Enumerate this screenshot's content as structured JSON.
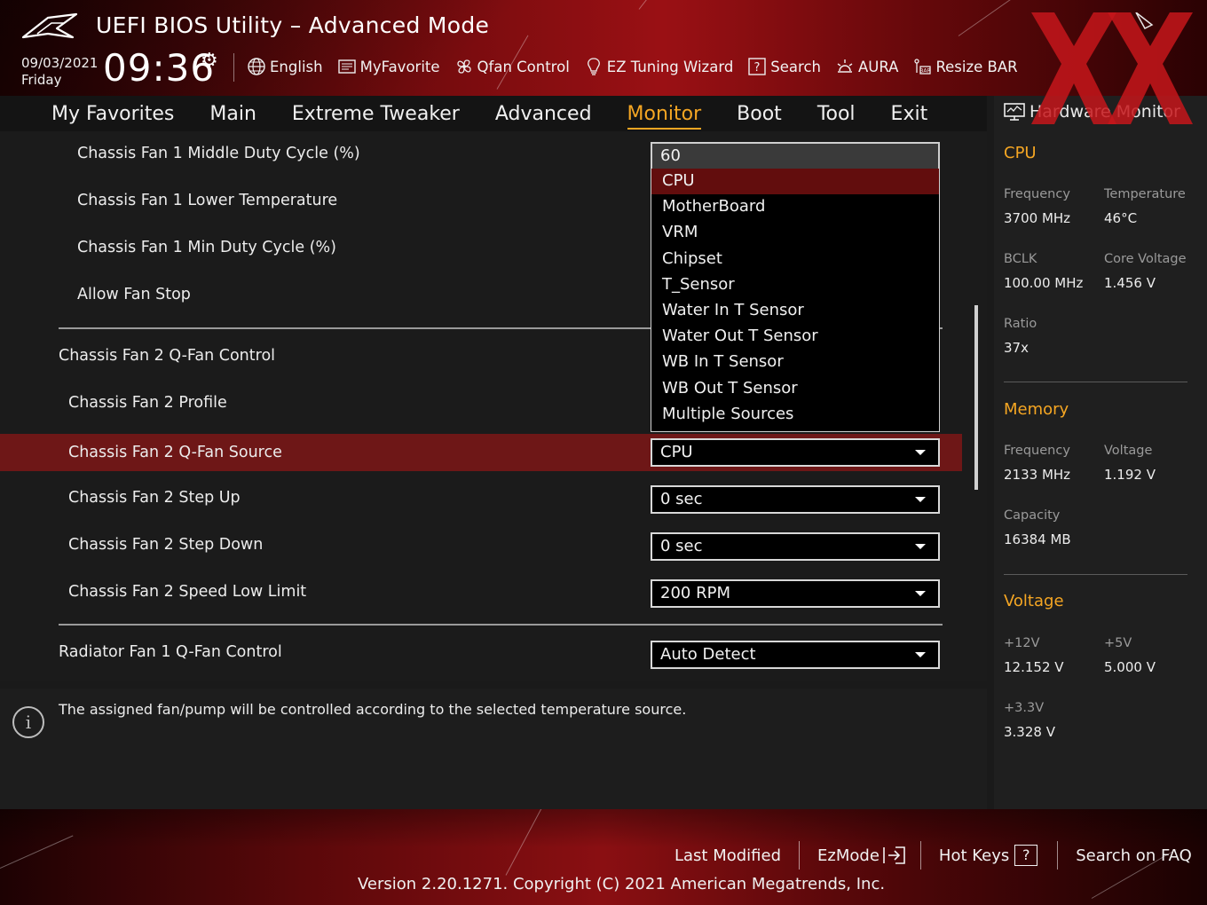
{
  "header": {
    "title": "UEFI BIOS Utility – Advanced Mode",
    "date": "09/03/2021",
    "day": "Friday",
    "time": "09:36",
    "toolbar": [
      {
        "label": "English",
        "icon": "globe-icon"
      },
      {
        "label": "MyFavorite",
        "icon": "favorite-icon"
      },
      {
        "label": "Qfan Control",
        "icon": "fan-icon"
      },
      {
        "label": "EZ Tuning Wizard",
        "icon": "lightbulb-icon"
      },
      {
        "label": "Search",
        "icon": "search-help-icon"
      },
      {
        "label": "AURA",
        "icon": "aura-icon"
      },
      {
        "label": "Resize BAR",
        "icon": "resize-bar-icon"
      }
    ]
  },
  "nav": {
    "tabs": [
      "My Favorites",
      "Main",
      "Extreme Tweaker",
      "Advanced",
      "Monitor",
      "Boot",
      "Tool",
      "Exit"
    ],
    "active": "Monitor"
  },
  "settings": {
    "rows": [
      {
        "label": "Chassis Fan 1 Middle Duty Cycle (%)"
      },
      {
        "label": "Chassis Fan 1 Lower Temperature"
      },
      {
        "label": "Chassis Fan 1 Min Duty Cycle (%)"
      },
      {
        "label": "Allow Fan Stop"
      },
      {
        "label": "Chassis Fan 2 Q-Fan Control"
      },
      {
        "label": "Chassis Fan 2 Profile"
      },
      {
        "label": "Chassis Fan 2 Q-Fan Source",
        "value": "CPU"
      },
      {
        "label": "Chassis Fan 2 Step Up",
        "value": "0 sec"
      },
      {
        "label": "Chassis Fan 2 Step Down",
        "value": "0 sec"
      },
      {
        "label": "Chassis Fan 2 Speed Low Limit",
        "value": "200 RPM"
      },
      {
        "label": "Radiator Fan 1 Q-Fan Control",
        "value": "Auto Detect"
      }
    ],
    "dropdown": {
      "field_value": "60",
      "options": [
        "CPU",
        "MotherBoard",
        "VRM",
        "Chipset",
        "T_Sensor",
        "Water In T Sensor",
        "Water Out T Sensor",
        "WB In T Sensor",
        "WB Out T Sensor",
        "Multiple Sources"
      ],
      "selected": "CPU"
    }
  },
  "help": {
    "text": "The assigned fan/pump will be controlled according to the selected temperature source."
  },
  "hardware_monitor": {
    "title": "Hardware Monitor",
    "cpu": {
      "section": "CPU",
      "frequency_label": "Frequency",
      "frequency": "3700 MHz",
      "temperature_label": "Temperature",
      "temperature": "46°C",
      "bclk_label": "BCLK",
      "bclk": "100.00 MHz",
      "core_voltage_label": "Core Voltage",
      "core_voltage": "1.456 V",
      "ratio_label": "Ratio",
      "ratio": "37x"
    },
    "memory": {
      "section": "Memory",
      "frequency_label": "Frequency",
      "frequency": "2133 MHz",
      "voltage_label": "Voltage",
      "voltage": "1.192 V",
      "capacity_label": "Capacity",
      "capacity": "16384 MB"
    },
    "voltage": {
      "section": "Voltage",
      "v12_label": "+12V",
      "v12": "12.152 V",
      "v5_label": "+5V",
      "v5": "5.000 V",
      "v33_label": "+3.3V",
      "v33": "3.328 V"
    }
  },
  "footer": {
    "last_modified": "Last Modified",
    "ezmode": "EzMode",
    "hot_keys": "Hot Keys",
    "hot_keys_glyph": "?",
    "search_faq": "Search on FAQ",
    "version": "Version 2.20.1271. Copyright (C) 2021 American Megatrends, Inc."
  },
  "colors": {
    "accent": "#f5a623",
    "highlight_row": "#6e1717",
    "dropdown_selected": "#620d0d",
    "brand_red": "#9a1014"
  }
}
